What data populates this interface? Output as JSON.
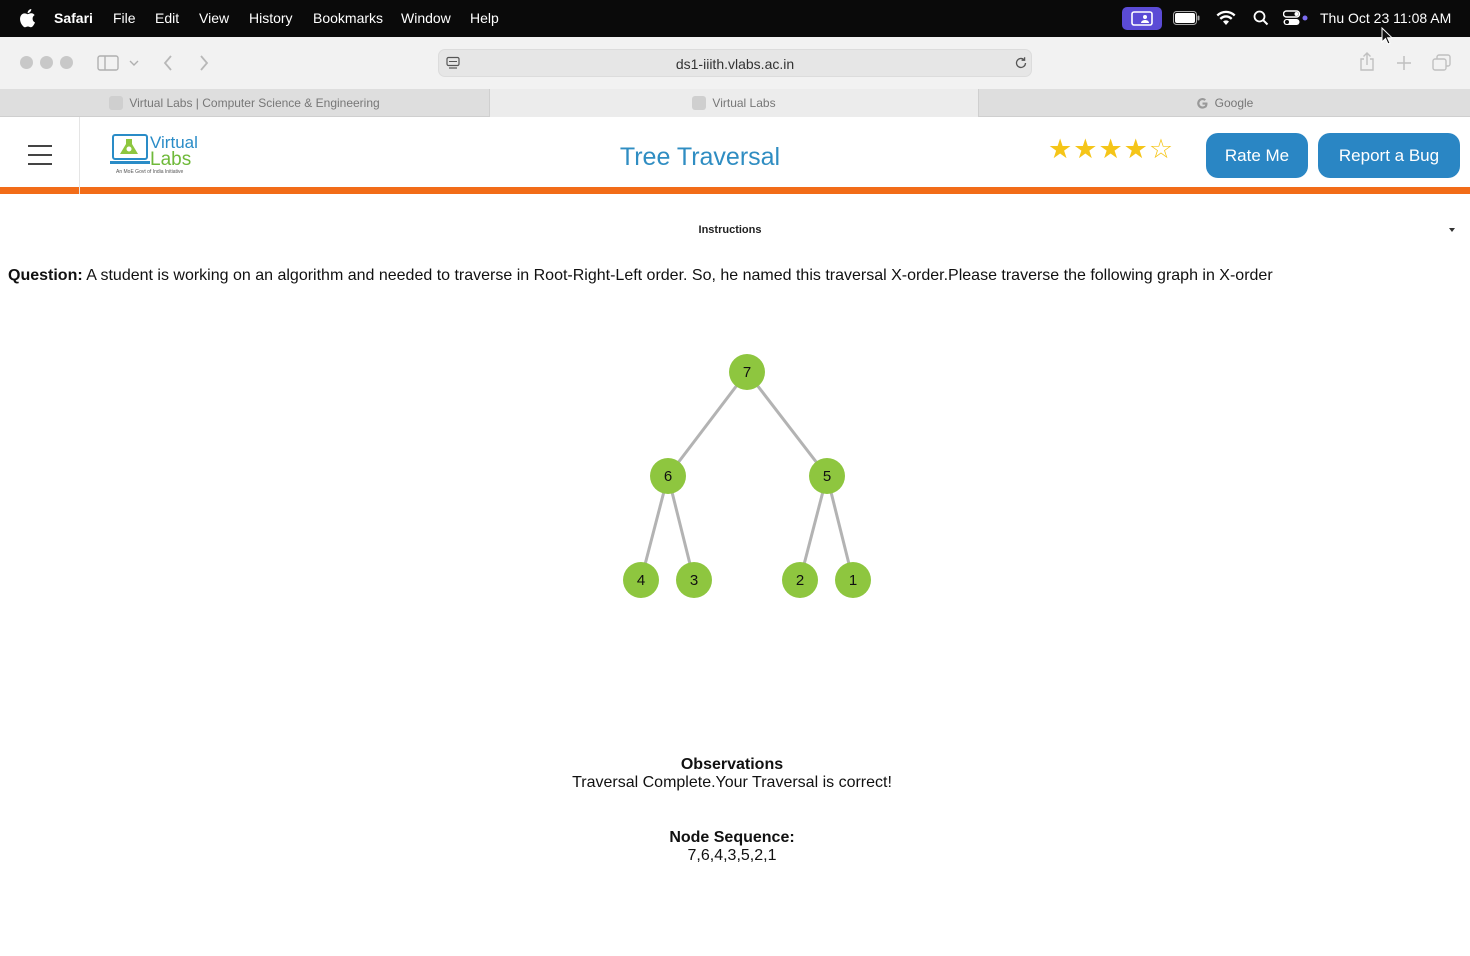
{
  "menubar": {
    "app": "Safari",
    "items": [
      "File",
      "Edit",
      "View",
      "History",
      "Bookmarks",
      "Window",
      "Help"
    ],
    "clock": "Thu Oct 23  11:08 AM"
  },
  "browser": {
    "url": "ds1-iiith.vlabs.ac.in",
    "tabs": [
      {
        "label": "Virtual Labs | Computer Science & Engineering"
      },
      {
        "label": "Virtual Labs"
      },
      {
        "label": "Google"
      }
    ]
  },
  "header": {
    "logo_line1": "Virtual",
    "logo_line2": "Labs",
    "logo_tagline": "An MoE Govt of India Initiative",
    "title": "Tree Traversal",
    "rating": {
      "filled": 4,
      "total": 5
    },
    "rate_button": "Rate Me",
    "bug_button": "Report a Bug"
  },
  "content": {
    "instructions": "Instructions",
    "question_label": "Question:",
    "question_text": " A student is working on an algorithm and needed to traverse in Root-Right-Left order. So, he named this traversal X-order.Please traverse the following graph in X-order",
    "tree": {
      "nodes": [
        "7",
        "6",
        "5",
        "4",
        "3",
        "2",
        "1"
      ],
      "node_color": "#8ec63f",
      "edge_color": "#b3b3b3"
    },
    "observations_title": "Observations",
    "observations_text": "Traversal Complete.Your Traversal is correct!",
    "sequence_title": "Node Sequence:",
    "sequence_value": "7,6,4,3,5,2,1"
  }
}
